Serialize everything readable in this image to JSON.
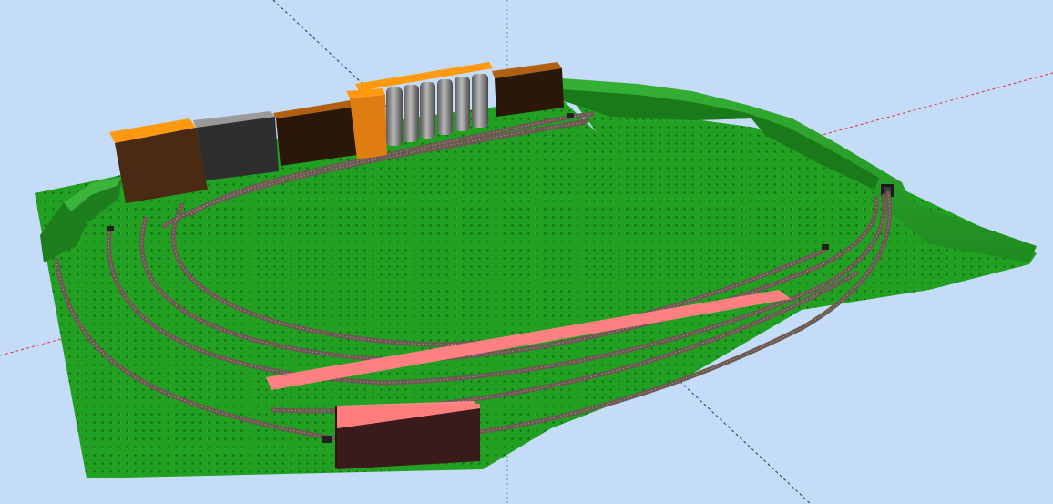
{
  "viewport": {
    "background_color": "#c4dcf8",
    "baseboard_color": "#22a022",
    "baseboard_dark_color": "#1a7a1a",
    "hill_color": "#2a9a2a",
    "track_color": "#6b5a52",
    "axis_x_color": "#e03030",
    "axis_y_color": "#30c050",
    "axis_z_color": "#203070"
  },
  "scene": {
    "buildings": [
      {
        "id": "warehouse-left",
        "top_color": "#ff9a10",
        "front_color": "#4a2a12",
        "side_color": "#2a1608"
      },
      {
        "id": "shed-grey",
        "top_color": "#9a9a9a",
        "front_color": "#2e2e2e"
      },
      {
        "id": "factory-brown",
        "top_color": "#b06010",
        "front_color": "#2a1708"
      },
      {
        "id": "tower-orange",
        "top_color": "#ff9a10",
        "front_color": "#e07d10"
      },
      {
        "id": "silos",
        "color": "#8c8c8c"
      },
      {
        "id": "factory-back",
        "top_color": "#b06010",
        "front_color": "#2a1708"
      },
      {
        "id": "station-platform",
        "color": "#ff8080"
      },
      {
        "id": "station-building",
        "top_color": "#ff8a8a",
        "front_color": "#3a1a1a"
      }
    ]
  }
}
